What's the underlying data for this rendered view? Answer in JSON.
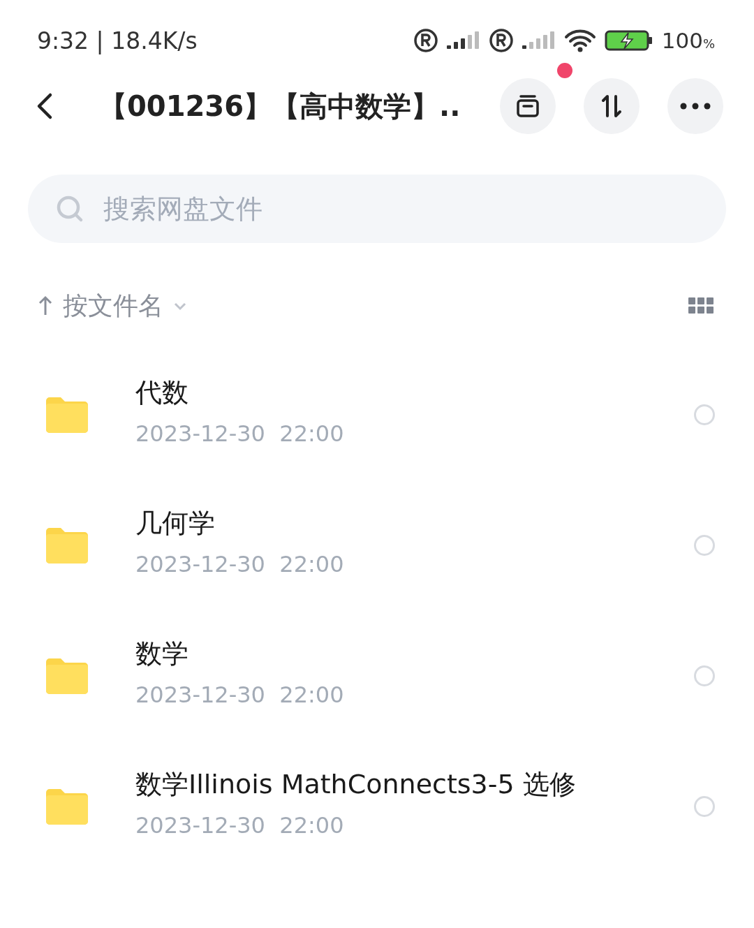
{
  "status_bar": {
    "time": "9:32 | 18.4K/s",
    "battery": "100",
    "battery_unit": "%"
  },
  "header": {
    "title": "【001236】【高中数学】..",
    "notification_dot": true
  },
  "search": {
    "placeholder": "搜索网盘文件"
  },
  "sort": {
    "label": "按文件名"
  },
  "files": [
    {
      "name": "代数",
      "date": "2023-12-30  22:00",
      "selected": false
    },
    {
      "name": "几何学",
      "date": "2023-12-30  22:00",
      "selected": false
    },
    {
      "name": "数学",
      "date": "2023-12-30  22:00",
      "selected": false
    },
    {
      "name": "数学Illinois MathConnects3-5 选修",
      "date": "2023-12-30  22:00",
      "selected": false
    }
  ]
}
